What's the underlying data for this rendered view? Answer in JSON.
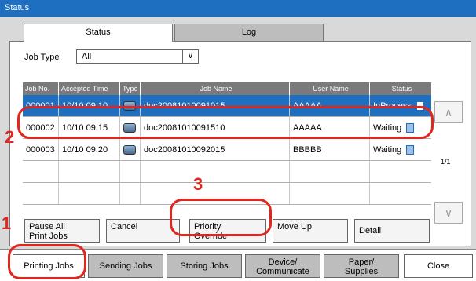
{
  "window": {
    "title": "Status"
  },
  "tabs": [
    {
      "label": "Status"
    },
    {
      "label": "Log"
    }
  ],
  "filter": {
    "label": "Job Type",
    "value": "All"
  },
  "table": {
    "headers": [
      "Job No.",
      "Accepted Time",
      "Type",
      "Job Name",
      "User Name",
      "Status"
    ],
    "rows": [
      {
        "job_no": "000001",
        "time": "10/10 09:10",
        "name": "doc20081010091015",
        "user": "AAAAA",
        "status": "InProcess"
      },
      {
        "job_no": "000002",
        "time": "10/10 09:15",
        "name": "doc20081010091510",
        "user": "AAAAA",
        "status": "Waiting"
      },
      {
        "job_no": "000003",
        "time": "10/10 09:20",
        "name": "doc20081010092015",
        "user": "BBBBB",
        "status": "Waiting"
      }
    ],
    "page": "1/1"
  },
  "actions": {
    "pause": "Pause All\nPrint Jobs",
    "cancel": "Cancel",
    "priority": "Priority\nOverride",
    "moveup": "Move Up",
    "detail": "Detail"
  },
  "bottom_tabs": {
    "printing": "Printing Jobs",
    "sending": "Sending Jobs",
    "storing": "Storing Jobs",
    "device": "Device/\nCommunicate",
    "paper": "Paper/\nSupplies",
    "close": "Close"
  },
  "annotations": {
    "a1": "1",
    "a2": "2",
    "a3": "3"
  },
  "colors": {
    "accent": "#1e6fc0",
    "callout": "#e0261f"
  }
}
